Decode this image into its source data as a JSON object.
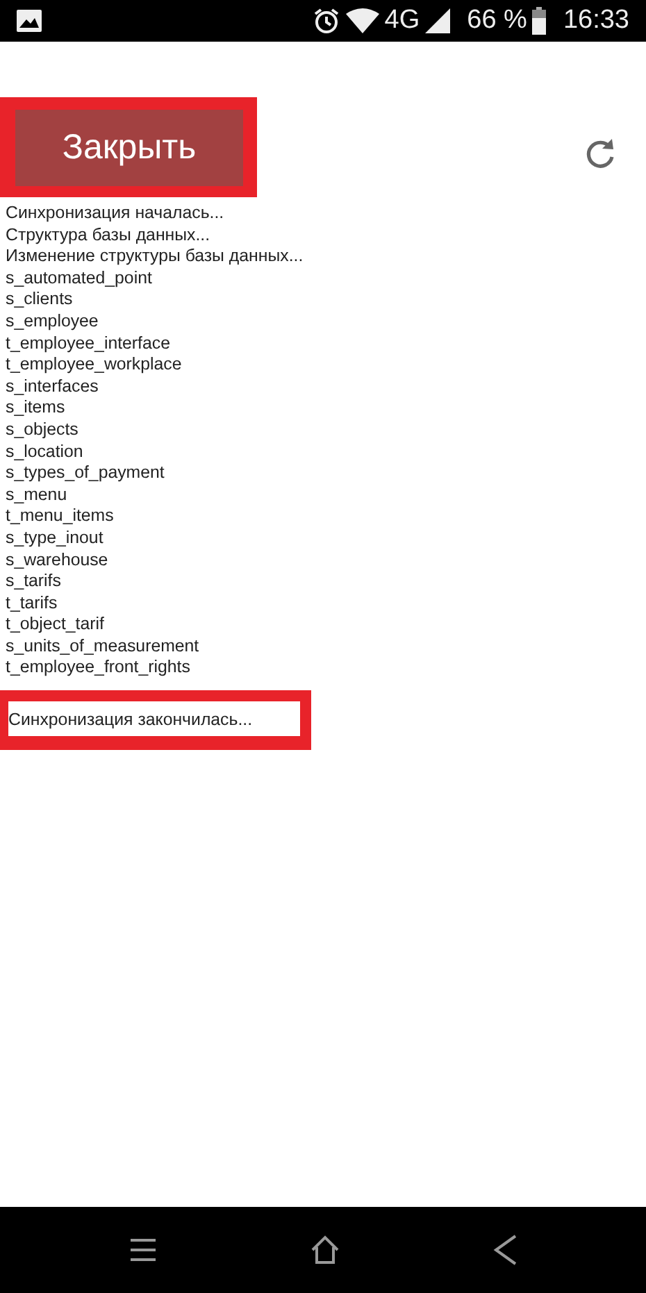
{
  "status_bar": {
    "network": "4G",
    "battery": "66 %",
    "time": "16:33"
  },
  "close_button": {
    "label": "Закрыть",
    "highlighted": true
  },
  "log_lines": [
    "Синхронизация началась...",
    "Структура базы данных...",
    "Изменение структуры базы данных...",
    "s_automated_point",
    "s_clients",
    "s_employee",
    "t_employee_interface",
    "t_employee_workplace",
    "s_interfaces",
    "s_items",
    "s_objects",
    "s_location",
    "s_types_of_payment",
    "s_menu",
    "t_menu_items",
    "s_type_inout",
    "s_warehouse",
    "s_tarifs",
    "t_tarifs",
    "t_object_tarif",
    "s_units_of_measurement",
    "t_employee_front_rights"
  ],
  "final_line": {
    "text": "Синхронизация закончилась...",
    "highlighted": true
  }
}
